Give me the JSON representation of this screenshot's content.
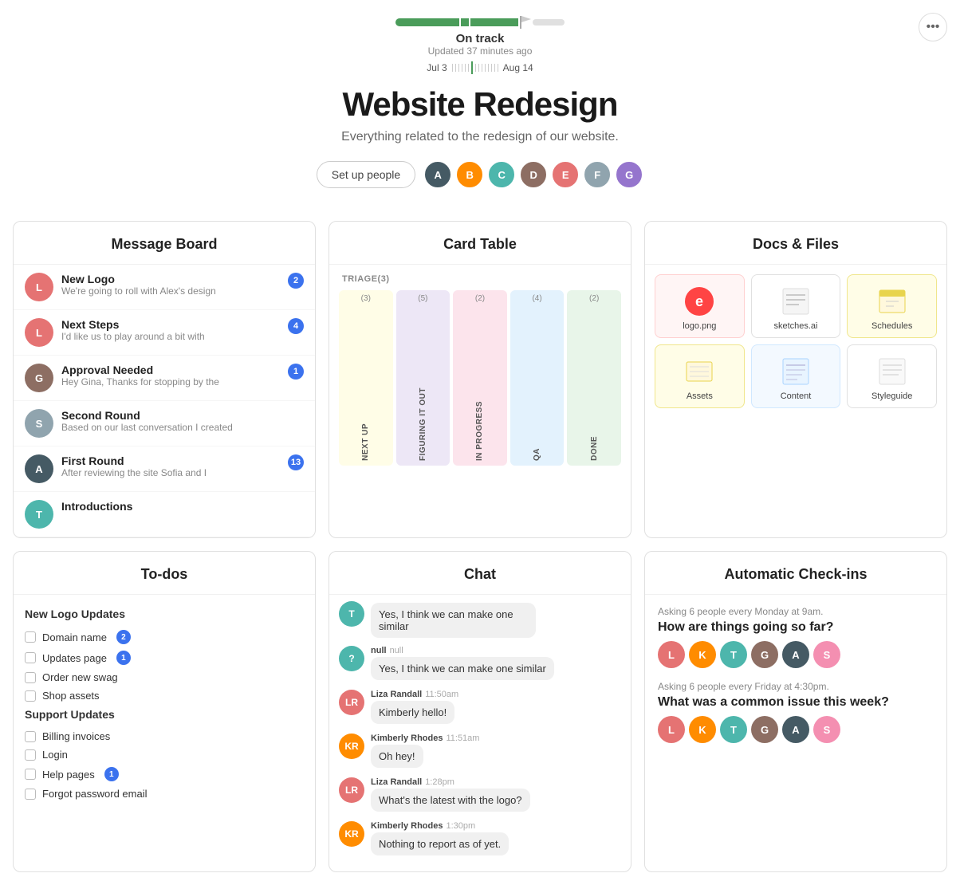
{
  "header": {
    "more_btn": "•••",
    "progress_status": "On track",
    "progress_updated": "Updated 37 minutes ago",
    "date_start": "Jul 3",
    "date_end": "Aug 14"
  },
  "project": {
    "title": "Website Redesign",
    "description": "Everything related to the redesign of our website.",
    "set_up_label": "Set up people"
  },
  "avatars": [
    {
      "color": "av-dark",
      "initials": "A"
    },
    {
      "color": "av-orange",
      "initials": "B"
    },
    {
      "color": "av-teal",
      "initials": "C"
    },
    {
      "color": "av-brown",
      "initials": "D"
    },
    {
      "color": "av-red",
      "initials": "E"
    },
    {
      "color": "av-gray",
      "initials": "F"
    },
    {
      "color": "av-purple",
      "initials": "G"
    }
  ],
  "message_board": {
    "title": "Message Board",
    "messages": [
      {
        "title": "New Logo",
        "preview": "We're going to roll with Alex's design",
        "badge": 2,
        "avatar_color": "av-red"
      },
      {
        "title": "Next Steps",
        "preview": "I'd like us to play around a bit with",
        "badge": 4,
        "avatar_color": "av-red"
      },
      {
        "title": "Approval Needed",
        "preview": "Hey Gina, Thanks for stopping by the",
        "badge": 1,
        "avatar_color": "av-brown"
      },
      {
        "title": "Second Round",
        "preview": "Based on our last conversation I created",
        "badge": null,
        "avatar_color": "av-gray"
      },
      {
        "title": "First Round",
        "preview": "After reviewing the site Sofia and I",
        "badge": 13,
        "avatar_color": "av-dark"
      },
      {
        "title": "Introductions",
        "preview": "",
        "badge": null,
        "avatar_color": "av-teal"
      }
    ]
  },
  "card_table": {
    "title": "Card Table",
    "triage_label": "TRIAGE",
    "triage_count": 3,
    "columns": [
      {
        "label": "NEXT UP",
        "count": 3,
        "color": "col-yellow"
      },
      {
        "label": "FIGURING IT OUT",
        "count": 5,
        "color": "col-lavender"
      },
      {
        "label": "IN PROGRESS",
        "count": 2,
        "color": "col-pink"
      },
      {
        "label": "QA",
        "count": 4,
        "color": "col-light-blue"
      },
      {
        "label": "DONE",
        "count": 2,
        "color": "col-green"
      }
    ]
  },
  "docs": {
    "title": "Docs & Files",
    "items": [
      {
        "label": "logo.png",
        "style": "doc-logo",
        "icon": "🔴",
        "is_image": true
      },
      {
        "label": "sketches.ai",
        "style": "doc-sketches",
        "icon": "📄",
        "is_image": false
      },
      {
        "label": "Schedules",
        "style": "doc-schedules",
        "icon": "📅",
        "is_image": false
      },
      {
        "label": "Assets",
        "style": "doc-assets",
        "icon": "🗂️",
        "is_image": false
      },
      {
        "label": "Content",
        "style": "doc-content",
        "icon": "📝",
        "is_image": false
      },
      {
        "label": "Styleguide",
        "style": "doc-styleguide",
        "icon": "🎨",
        "is_image": false
      }
    ]
  },
  "todos": {
    "title": "To-dos",
    "sections": [
      {
        "title": "New Logo Updates",
        "items": [
          {
            "label": "Domain name",
            "badge": 2
          },
          {
            "label": "Updates page",
            "badge": 1
          },
          {
            "label": "Order new swag",
            "badge": null
          },
          {
            "label": "Shop assets",
            "badge": null
          }
        ]
      },
      {
        "title": "Support Updates",
        "items": [
          {
            "label": "Billing invoices",
            "badge": null
          },
          {
            "label": "Login",
            "badge": null
          },
          {
            "label": "Help pages",
            "badge": 1
          },
          {
            "label": "Forgot password email",
            "badge": null
          }
        ]
      }
    ]
  },
  "chat": {
    "title": "Chat",
    "messages": [
      {
        "sender": null,
        "time": null,
        "text": "Yes, I think we can make one similar",
        "is_system": true,
        "avatar_color": "av-teal"
      },
      {
        "sender": "Liza Randall",
        "time": "11:50am",
        "text": "Kimberly hello!",
        "avatar_color": "av-red"
      },
      {
        "sender": "Kimberly Rhodes",
        "time": "11:51am",
        "text": "Oh hey!",
        "avatar_color": "av-orange"
      },
      {
        "sender": "Liza Randall",
        "time": "1:28pm",
        "text": "What's the latest with the logo?",
        "avatar_color": "av-red"
      },
      {
        "sender": "Kimberly Rhodes",
        "time": "1:30pm",
        "text": "Nothing to report as of yet.",
        "avatar_color": "av-orange"
      }
    ]
  },
  "checkins": {
    "title": "Automatic Check-ins",
    "items": [
      {
        "asking": "Asking 6 people every Monday at 9am.",
        "question": "How are things going so far?",
        "avatar_colors": [
          "av-red",
          "av-orange",
          "av-teal",
          "av-brown",
          "av-dark",
          "av-pink"
        ]
      },
      {
        "asking": "Asking 6 people every Friday at 4:30pm.",
        "question": "What was a common issue this week?",
        "avatar_colors": [
          "av-red",
          "av-orange",
          "av-teal",
          "av-brown",
          "av-dark",
          "av-pink"
        ]
      }
    ]
  }
}
